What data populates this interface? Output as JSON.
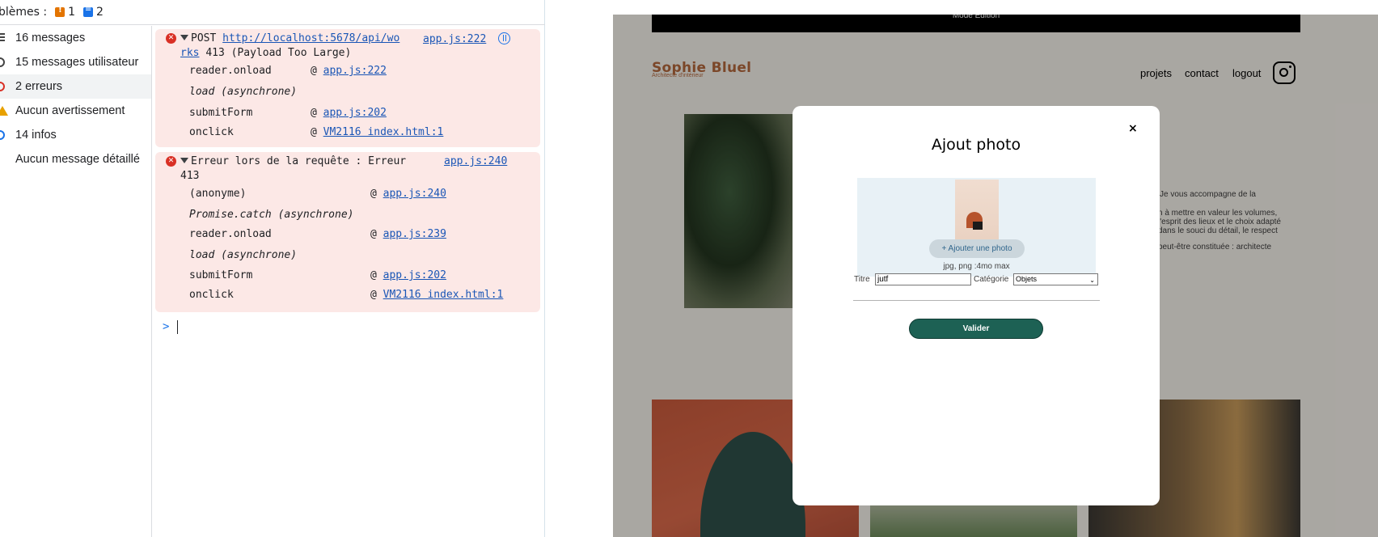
{
  "devtools": {
    "problems": {
      "label": "blèmes :",
      "warn_count": "1",
      "info_count": "2"
    },
    "sidebar": {
      "items": [
        {
          "label": "16 messages"
        },
        {
          "label": "15 messages utilisateur"
        },
        {
          "label": "2 erreurs"
        },
        {
          "label": "Aucun avertissement"
        },
        {
          "label": "14 infos"
        },
        {
          "label": "Aucun message détaillé"
        }
      ]
    },
    "console": {
      "error1": {
        "method": "POST",
        "url_part1": "http://localhost:5678/api/wo",
        "url_part2": "rks",
        "status": "413 (Payload Too Large)",
        "source": "app.js:222",
        "stack": [
          {
            "fn": "reader.onload",
            "at": "@",
            "link": "app.js:222"
          },
          {
            "fn": "load (asynchrone)"
          },
          {
            "fn": "submitForm",
            "at": "@",
            "link": "app.js:202"
          },
          {
            "fn": "onclick",
            "at": "@",
            "link": "VM2116 index.html:1"
          }
        ]
      },
      "error2": {
        "text": "Erreur lors de la requête : Erreur",
        "code": "413",
        "source": "app.js:240",
        "stack": [
          {
            "fn": "(anonyme)",
            "at": "@",
            "link": "app.js:240"
          },
          {
            "fn": "Promise.catch (asynchrone)"
          },
          {
            "fn": "reader.onload",
            "at": "@",
            "link": "app.js:239"
          },
          {
            "fn": "load (asynchrone)"
          },
          {
            "fn": "submitForm",
            "at": "@",
            "link": "app.js:202"
          },
          {
            "fn": "onclick",
            "at": "@",
            "link": "VM2116 index.html:1"
          }
        ]
      },
      "prompt": ">"
    }
  },
  "site": {
    "edit_bar": "Mode Edition",
    "logo": "Sophie Bluel",
    "logo_sub": "Architecte d'intérieur",
    "nav": [
      "projets",
      "contact",
      "logout"
    ],
    "about_lines": [
      "Je vous accompagne de la",
      "n à mettre en valeur les volumes,",
      "l'esprit des lieux et le choix adapté",
      "dans le souci du détail, le respect",
      "peut-être constituée : architecte"
    ]
  },
  "modal": {
    "close": "×",
    "title": "Ajout photo",
    "add_photo": "+ Ajouter une photo",
    "hint": "jpg, png :4mo max",
    "title_label": "Titre",
    "title_value": "jutf",
    "category_label": "Catégorie",
    "category_value": "Objets",
    "validate": "Valider"
  },
  "colors": {
    "error_bg": "#fce8e6",
    "link": "#1a56b6",
    "brand": "#b1663c",
    "validate_bg": "#1d6154"
  }
}
